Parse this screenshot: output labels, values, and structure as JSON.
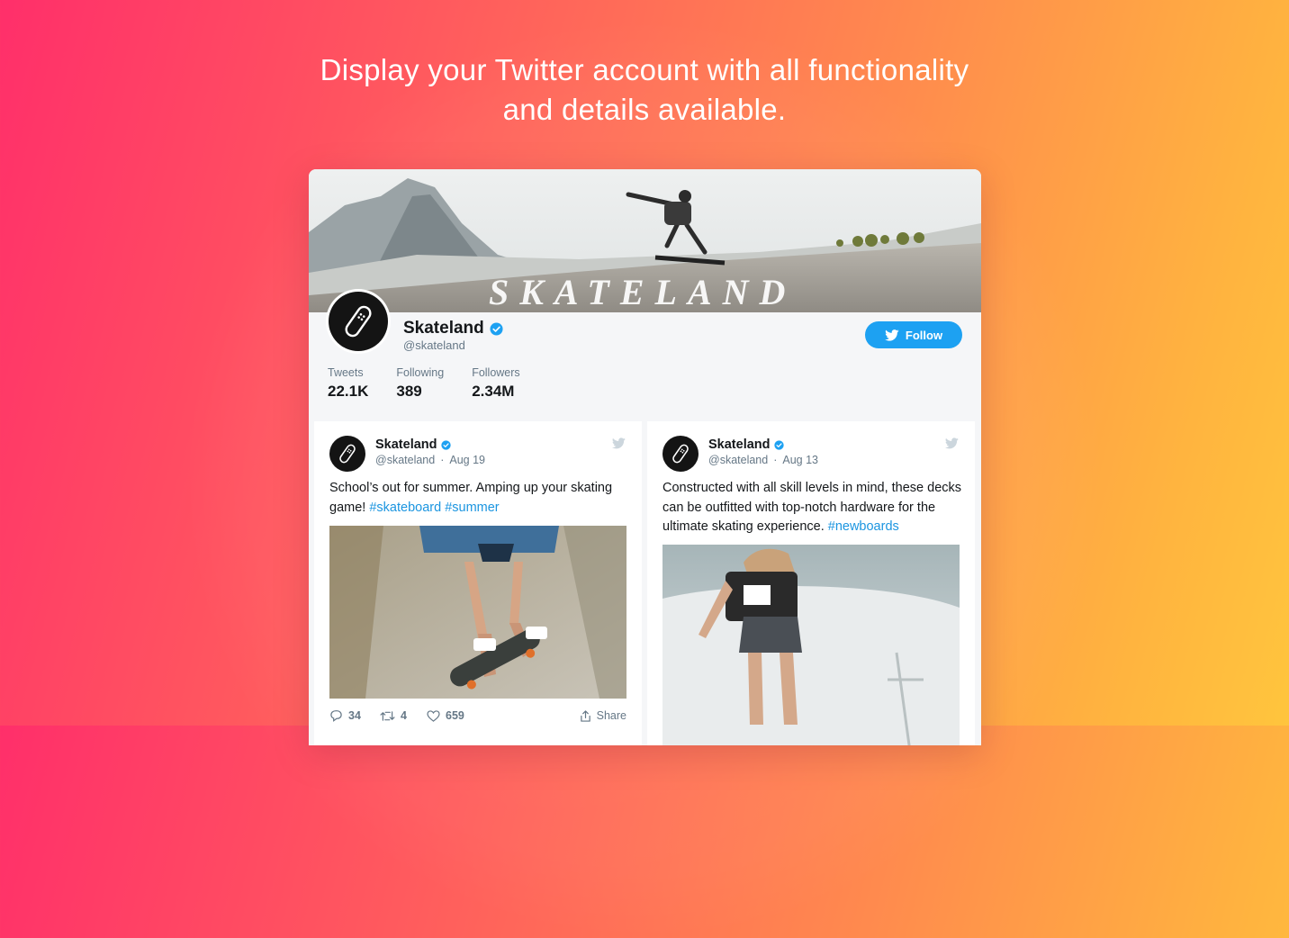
{
  "headline": {
    "line1": "Display your Twitter account with all functionality",
    "line2": "and details available."
  },
  "profile": {
    "banner_text": "SKATELAND",
    "name": "Skateland",
    "handle": "@skateland",
    "follow_label": "Follow",
    "stats": [
      {
        "label": "Tweets",
        "value": "22.1K"
      },
      {
        "label": "Following",
        "value": "389"
      },
      {
        "label": "Followers",
        "value": "2.34M"
      }
    ]
  },
  "tweets": [
    {
      "name": "Skateland",
      "handle": "@skateland",
      "date": "Aug 19",
      "text": "School’s out for summer. Amping up your skating game! ",
      "hashtags": [
        "#skateboard",
        "#summer"
      ],
      "replies": "34",
      "retweets": "4",
      "likes": "659",
      "share_label": "Share"
    },
    {
      "name": "Skateland",
      "handle": "@skateland",
      "date": "Aug 13",
      "text": "Constructed with all skill levels in mind, these decks can be outfitted with top-notch hardware for the ultimate skating experience. ",
      "hashtags": [
        "#newboards"
      ]
    }
  ],
  "colors": {
    "twitter_blue": "#1da1f2",
    "hashtag_blue": "#1b95e0",
    "gradient_left": "#ff2f6a",
    "gradient_right": "#ffc53d"
  },
  "icons": [
    "verified-badge-icon",
    "twitter-bird-icon",
    "reply-icon",
    "retweet-icon",
    "like-icon",
    "share-icon",
    "skateboard-logo-icon"
  ]
}
